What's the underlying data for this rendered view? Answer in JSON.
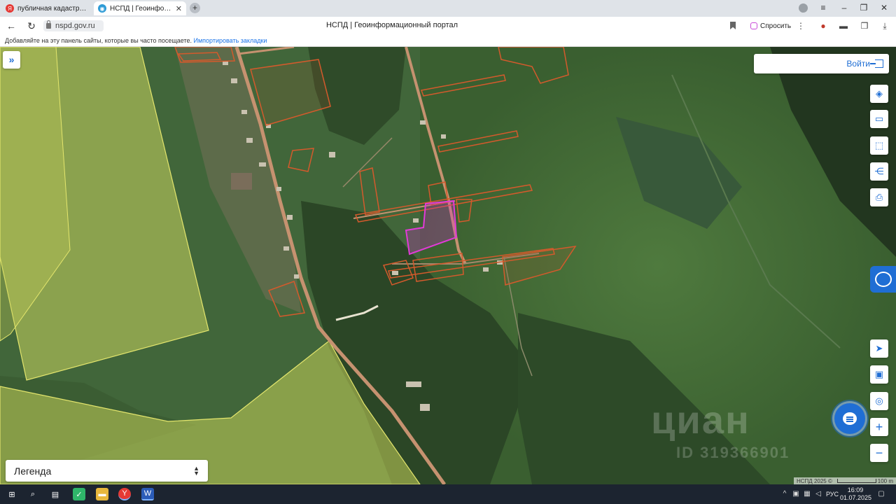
{
  "browser": {
    "tabs": [
      {
        "title": "публичная кадастровая к",
        "active": false
      },
      {
        "title": "НСПД | Геоинформаци",
        "active": true
      }
    ],
    "url": "nspd.gov.ru",
    "page_title": "НСПД | Геоинформационный портал",
    "ask_label": "Спросить",
    "bookmarks_hint": "Добавляйте на эту панель сайты, которые вы часто посещаете.",
    "bookmarks_import": "Импортировать закладки"
  },
  "map": {
    "login_label": "Войти",
    "legend_label": "Легенда",
    "watermark": "циан",
    "watermark_id": "ID 319366901",
    "attribution": "НСПД 2025 ©",
    "scale_label": "100 m",
    "tools": [
      "layers-icon",
      "ruler-icon",
      "area-select-icon",
      "share-icon",
      "print-icon"
    ],
    "controls": [
      "locate-icon",
      "picture-in-picture-icon",
      "place-icon",
      "zoom-in-icon",
      "zoom-out-icon"
    ]
  },
  "taskbar": {
    "lang": "РУС",
    "time": "16:09",
    "date": "01.07.2025"
  },
  "colors": {
    "accent": "#1f6ed4",
    "parcel_outline": "#d45a2c",
    "selected_parcel": "#d62bd0",
    "zone_fill": "#d8e06a"
  }
}
